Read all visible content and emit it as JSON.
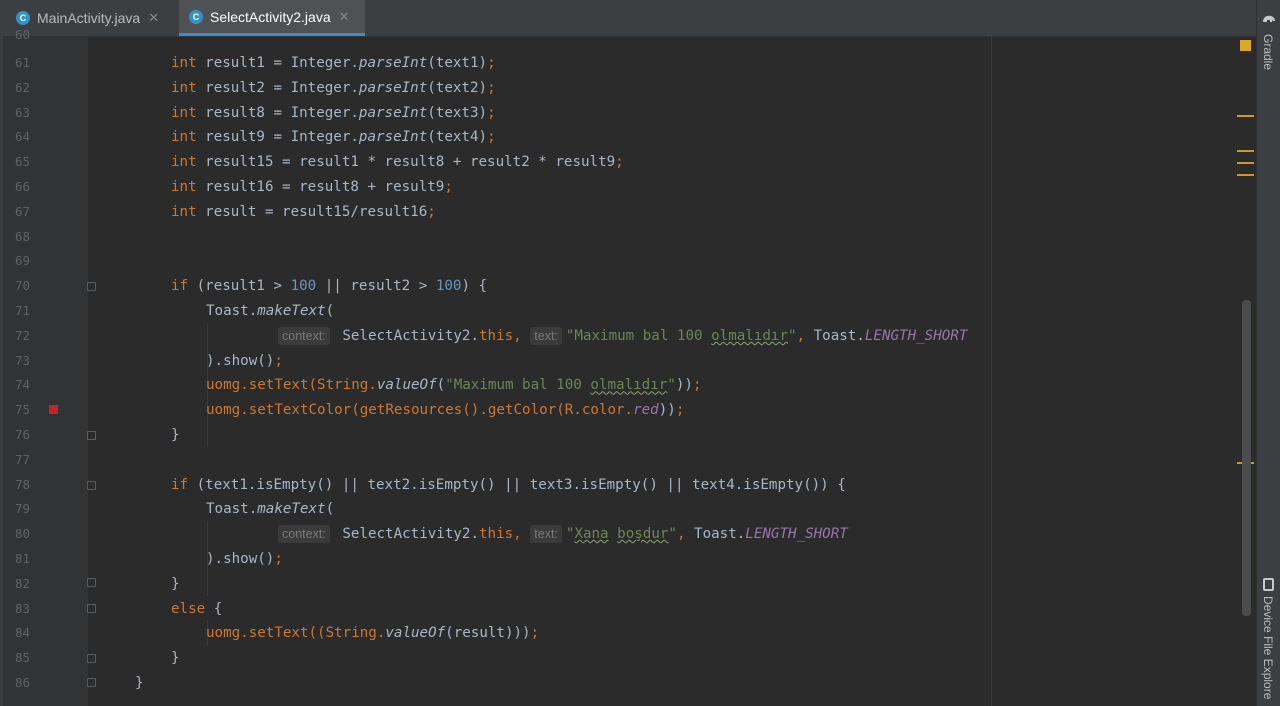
{
  "tabs": [
    {
      "label": "MainActivity.java",
      "icon": "C",
      "active": false
    },
    {
      "label": "SelectActivity2.java",
      "icon": "C",
      "active": true
    }
  ],
  "right_toolbar": {
    "gradle": "Gradle",
    "device_explorer": "Device File Explore"
  },
  "partial_line_number": "60",
  "line_numbers": [
    "61",
    "62",
    "63",
    "64",
    "65",
    "66",
    "67",
    "68",
    "69",
    "70",
    "71",
    "72",
    "73",
    "74",
    "75",
    "76",
    "77",
    "78",
    "79",
    "80",
    "81",
    "82",
    "83",
    "84",
    "85",
    "86"
  ],
  "code": {
    "l61": {
      "kw": "int",
      "a": " result1 = Integer.",
      "m": "parseInt",
      "b": "(text1)",
      "sc": ";"
    },
    "l62": {
      "kw": "int",
      "a": " result2 = Integer.",
      "m": "parseInt",
      "b": "(text2)",
      "sc": ";"
    },
    "l63": {
      "kw": "int",
      "a": " result8 = Integer.",
      "m": "parseInt",
      "b": "(text3)",
      "sc": ";"
    },
    "l64": {
      "kw": "int",
      "a": " result9 = Integer.",
      "m": "parseInt",
      "b": "(text4)",
      "sc": ";"
    },
    "l65": {
      "kw": "int",
      "a": " result15 = result1 * result8 + result2 * result9",
      "sc": ";"
    },
    "l66": {
      "kw": "int",
      "a": " result16 = result8 + result9",
      "sc": ";"
    },
    "l67": {
      "kw": "int",
      "a": " result = result15/result16",
      "sc": ";"
    },
    "l70": {
      "kw": "if",
      "a": " (result1 > ",
      "n1": "100",
      "b": " || result2 > ",
      "n2": "100",
      "c": ") {"
    },
    "l71": {
      "a": "Toast.",
      "m": "makeText",
      "b": "("
    },
    "l72": {
      "hint1": "context:",
      "a": " SelectActivity2.",
      "kw": "this,",
      "hint2": "text:",
      "s1": "\"Maximum bal 100 ",
      "s2": "olmalıdır",
      "s3": "\"",
      "comma": ",",
      "b": " Toast.",
      "f": "LENGTH_SHORT"
    },
    "l73": {
      "a": ").show()",
      "sc": ";"
    },
    "l74": {
      "a": "uomg.setText(String.",
      "m": "valueOf",
      "b": "(",
      "s1": "\"Maximum bal 100 ",
      "s2": "olmalıdır",
      "s3": "\"",
      "c": "))",
      "sc": ";"
    },
    "l75": {
      "a": "uomg.setTextColor(getResources().getColor(R.color.",
      "f": "red",
      "b": "))",
      "sc": ";"
    },
    "l76": {
      "a": "}"
    },
    "l78": {
      "kw": "if",
      "a": " (text1.isEmpty() || text2.isEmpty() || text3.isEmpty() || text4.isEmpty()) {"
    },
    "l79": {
      "a": "Toast.",
      "m": "makeText",
      "b": "("
    },
    "l80": {
      "hint1": "context:",
      "a": " SelectActivity2.",
      "kw": "this,",
      "hint2": "text:",
      "s1": "\"",
      "s2": "Xana",
      "s2b": " ",
      "s3": "boşdur",
      "s4": "\"",
      "comma": ",",
      "b": " Toast.",
      "f": "LENGTH_SHORT"
    },
    "l81": {
      "a": ").show()",
      "sc": ";"
    },
    "l82": {
      "a": "}"
    },
    "l83": {
      "kw": "else",
      "a": " {"
    },
    "l84": {
      "a": "uomg.setText((String.",
      "m": "valueOf",
      "b": "(result)))",
      "sc": ";"
    },
    "l85": {
      "a": "}"
    },
    "l86": {
      "a": "}"
    }
  },
  "colors": {
    "background": "#2b2b2b",
    "keyword": "#cc7832",
    "number": "#6897bb",
    "string": "#6a8759",
    "field": "#9876aa",
    "text": "#a9b7c6",
    "breakpoint": "#c7222d"
  }
}
